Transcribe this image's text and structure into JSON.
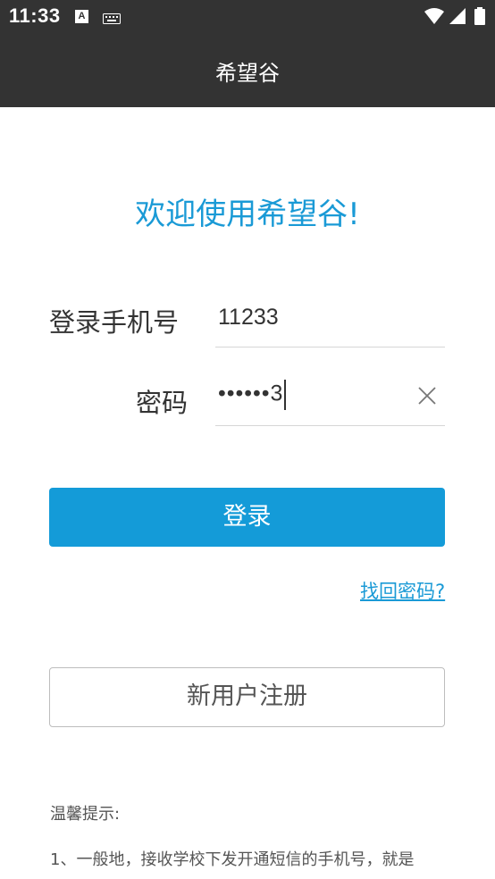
{
  "status_bar": {
    "time": "11:33",
    "a_badge": "A",
    "icons": [
      "keyboard-icon",
      "wifi-icon",
      "signal-icon",
      "battery-icon"
    ]
  },
  "app_bar": {
    "title": "希望谷"
  },
  "welcome": "欢迎使用希望谷!",
  "form": {
    "phone_label": "登录手机号",
    "phone_value": "11233",
    "password_label": "密码",
    "password_value": "••••••3"
  },
  "login_label": "登录",
  "forgot_label": "找回密码?",
  "register_label": "新用户注册",
  "tips": {
    "title": "温馨提示:",
    "line1": "1、一般地，接收学校下发开通短信的手机号，就是"
  },
  "colors": {
    "bar_bg": "#333333",
    "accent": "#149bd8",
    "text_dark": "#333333",
    "text_gray": "#555555",
    "divider": "#d6d6d6"
  }
}
